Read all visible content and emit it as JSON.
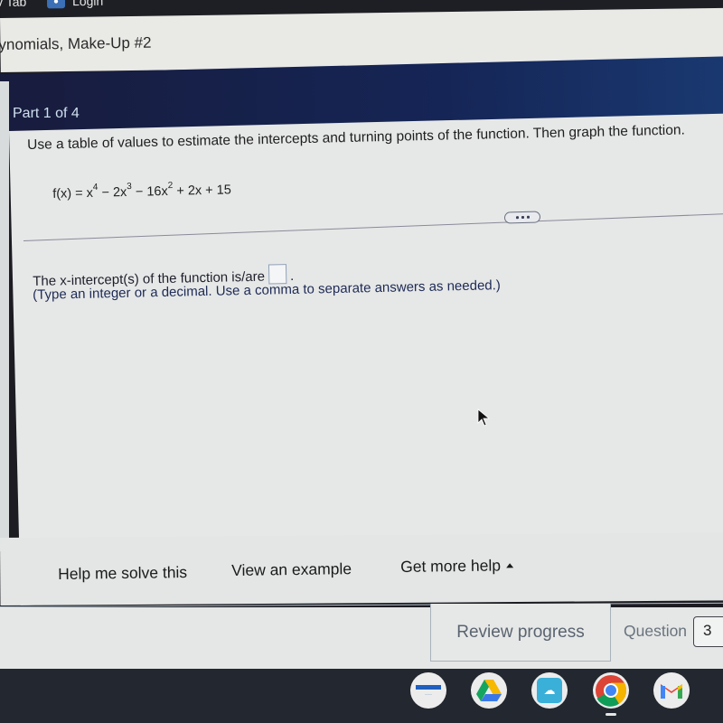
{
  "browser": {
    "bookmarks": [
      {
        "label": "v Tab",
        "icon": "tab-icon"
      },
      {
        "label": "Login",
        "icon": "login-icon"
      }
    ]
  },
  "page": {
    "title": "ynomials, Make-Up #2"
  },
  "question": {
    "part_label": "Part 1 of 4",
    "instructions": "Use a table of values to estimate the intercepts and turning points of the function. Then graph the function.",
    "equation": {
      "lhs": "f(x) = x",
      "exp1": "4",
      "t2": " − 2x",
      "exp2": "3",
      "t3": " − 16x",
      "exp3": "2",
      "t4": " + 2x + 15"
    },
    "more_button_label": "...",
    "answer_prompt": "The x-intercept(s) of the function is/are",
    "answer_value": "",
    "answer_suffix": ".",
    "hint": "(Type an integer or a decimal. Use a comma to separate answers as needed.)"
  },
  "help": {
    "solve": "Help me solve this",
    "example": "View an example",
    "more": "Get more help"
  },
  "footer": {
    "review_progress": "Review progress",
    "question_label": "Question",
    "question_number": "3"
  },
  "shelf": {
    "apps": [
      {
        "name": "Pearson",
        "icon": "pearson-icon",
        "brand_label": "PEARSON"
      },
      {
        "name": "Google Drive",
        "icon": "drive-icon"
      },
      {
        "name": "Cloud app",
        "icon": "cloud-icon"
      },
      {
        "name": "Chrome",
        "icon": "chrome-icon",
        "active": true
      },
      {
        "name": "Gmail",
        "icon": "gmail-icon"
      }
    ]
  },
  "colors": {
    "header_bg": "#152556",
    "content_bg": "#e6e8e7",
    "hint_text": "#1e2a56",
    "shelf_bg": "#23272f"
  }
}
